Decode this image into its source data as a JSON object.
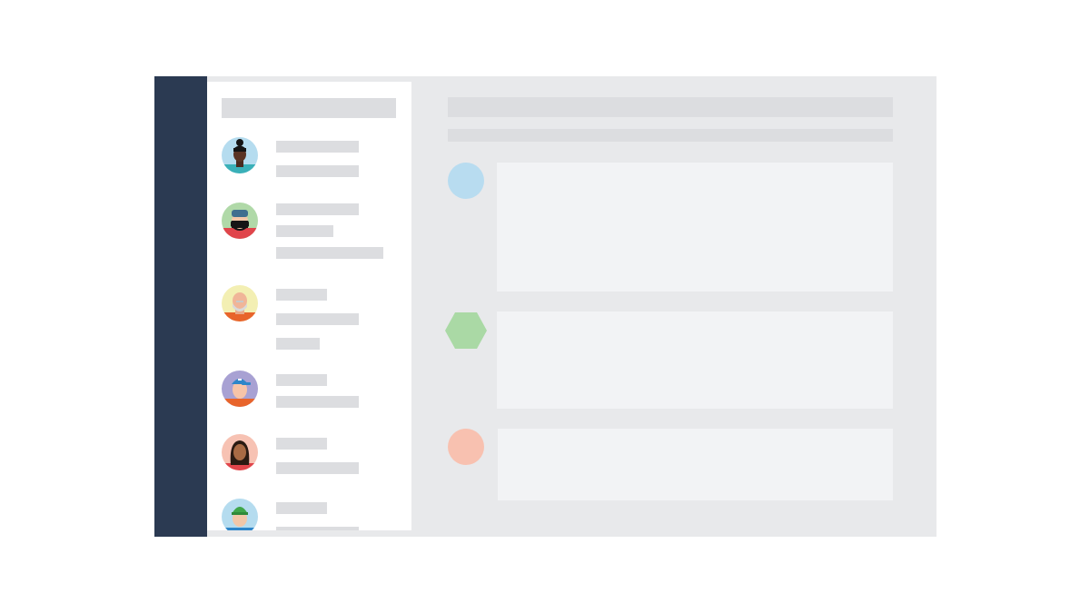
{
  "app": {
    "colors": {
      "background": "#ffffff",
      "window": "#e8e9eb",
      "nav_rail": "#2b3a52",
      "sidebar": "#ffffff",
      "placeholder": "#dcdde0",
      "card": "#f2f3f5"
    }
  },
  "sidebar": {
    "search_placeholder": "",
    "contacts": [
      {
        "avatar_icon": "person-bun-icon",
        "avatar_bg": "#b5dcef"
      },
      {
        "avatar_icon": "person-beard-beanie-icon",
        "avatar_bg": "#b0d9a8"
      },
      {
        "avatar_icon": "person-bald-beard-icon",
        "avatar_bg": "#f3efb3"
      },
      {
        "avatar_icon": "person-cap-icon",
        "avatar_bg": "#a8a1d3"
      },
      {
        "avatar_icon": "person-long-hair-icon",
        "avatar_bg": "#f7c2b3"
      },
      {
        "avatar_icon": "person-green-beanie-icon",
        "avatar_bg": "#b5dcef"
      }
    ]
  },
  "main": {
    "messages": [
      {
        "marker_icon": "blue-circle-icon",
        "marker_color": "#b8dcf0"
      },
      {
        "marker_icon": "green-hexagon-icon",
        "marker_color": "#aad9a5"
      },
      {
        "marker_icon": "peach-circle-icon",
        "marker_color": "#f8c1b0"
      }
    ]
  }
}
